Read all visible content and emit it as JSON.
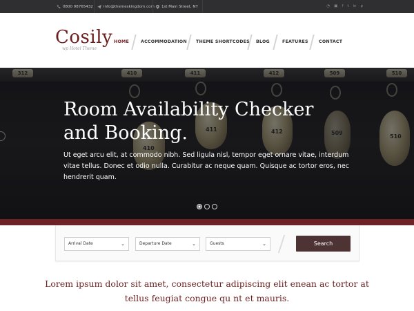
{
  "topbar": {
    "phone": "0800 98765432",
    "email": "info@themeskingdom.com",
    "address": "1st Main Street, NY",
    "socials": [
      "rss-icon",
      "instagram-icon",
      "facebook-icon",
      "twitter-icon",
      "linkedin-icon",
      "pinterest-icon"
    ]
  },
  "logo": {
    "name": "Cosily",
    "tagline": "wp Hotel Theme"
  },
  "nav": {
    "items": [
      "HOME",
      "ACCOMMODATION",
      "THEME SHORTCODES",
      "BLOG",
      "FEATURES",
      "CONTACT"
    ],
    "active_index": 0
  },
  "hero": {
    "title_line1": "Room Availability Checker",
    "title_line2": "and Booking.",
    "text": "Ut eget arcu elit, at commodo nibh. Sed ligula nisl, tempor eget ornare vitae, interdum vitae tellus. Donec et odio nulla. Curabitur ac neque quam. Quisque ac tortor eros, nec hendrerit quam.",
    "room_numbers": [
      "312",
      "410",
      "411",
      "412",
      "509",
      "510"
    ],
    "tag_numbers": [
      "411",
      "410",
      "412",
      "509",
      "510"
    ],
    "slide_count": 3,
    "active_slide": 1
  },
  "booking": {
    "arrival": "Arrival Date",
    "departure": "Departure Date",
    "guests": "Guests",
    "search": "Search"
  },
  "intro": {
    "text": "Lorem ipsum dolor sit amet, consectetur adipiscing elit enean ac tortor at tellus feugiat congue qu nt et mauris."
  },
  "colors": {
    "brand": "#6a1e1e",
    "topbar": "#2f2f31",
    "search_button": "#4e3334",
    "accent_bar": "#6d2226"
  }
}
